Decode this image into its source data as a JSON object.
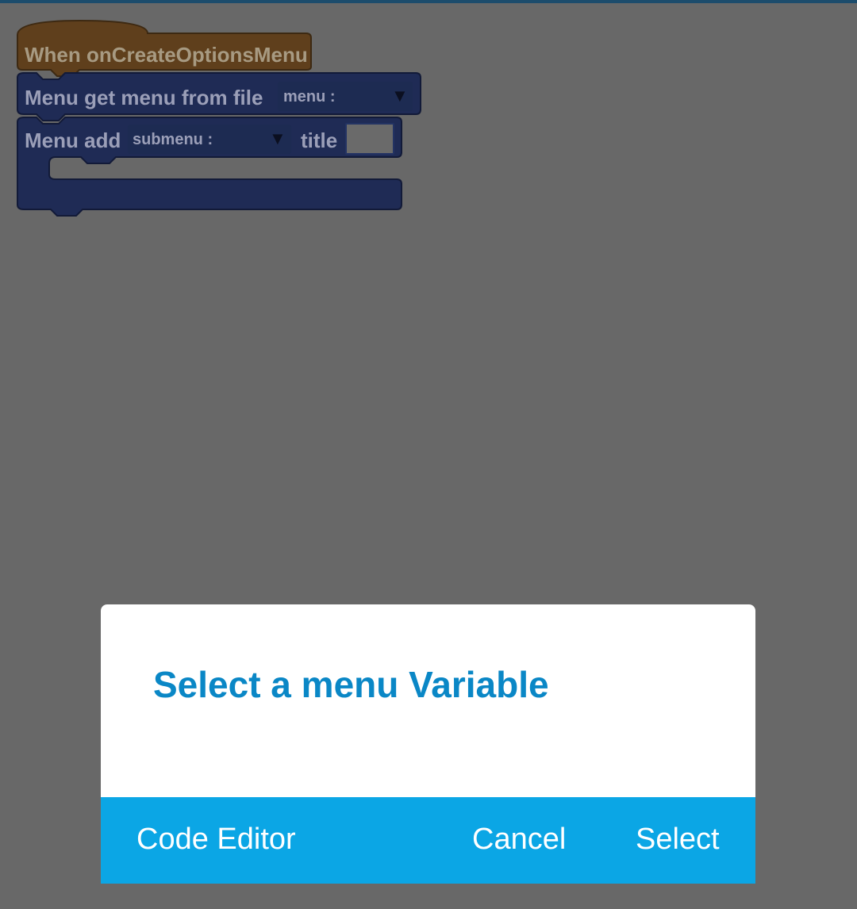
{
  "blocks": {
    "event": {
      "text": "When onCreateOptionsMenu"
    },
    "get_menu": {
      "text": "Menu get menu from file",
      "dropdown_label": "menu :",
      "dropdown_arrow": "▼"
    },
    "add_submenu": {
      "prefix": "Menu add",
      "dropdown_label": "submenu :",
      "dropdown_arrow": "▼",
      "title_label": "title",
      "title_value": ""
    }
  },
  "dialog": {
    "title": "Select a menu Variable",
    "buttons": {
      "left": "Code Editor",
      "cancel": "Cancel",
      "select": "Select"
    }
  },
  "colors": {
    "background_dim": "#686868",
    "event_block": "#5f3f1c",
    "menu_block": "#1f2b55",
    "dialog_title": "#0a87c6",
    "dialog_bar": "#0ba6e5"
  }
}
